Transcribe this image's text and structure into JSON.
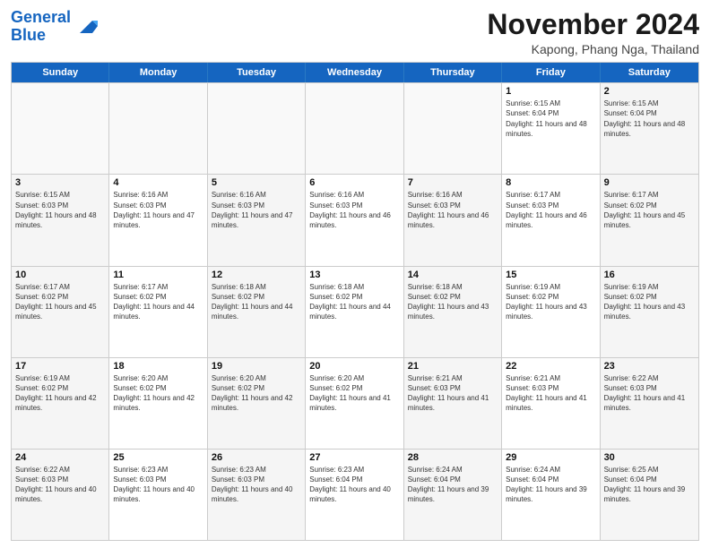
{
  "logo": {
    "line1": "General",
    "line2": "Blue"
  },
  "title": "November 2024",
  "subtitle": "Kapong, Phang Nga, Thailand",
  "days_of_week": [
    "Sunday",
    "Monday",
    "Tuesday",
    "Wednesday",
    "Thursday",
    "Friday",
    "Saturday"
  ],
  "weeks": [
    [
      {
        "day": "",
        "sunrise": "",
        "sunset": "",
        "daylight": "",
        "empty": true
      },
      {
        "day": "",
        "sunrise": "",
        "sunset": "",
        "daylight": "",
        "empty": true
      },
      {
        "day": "",
        "sunrise": "",
        "sunset": "",
        "daylight": "",
        "empty": true
      },
      {
        "day": "",
        "sunrise": "",
        "sunset": "",
        "daylight": "",
        "empty": true
      },
      {
        "day": "",
        "sunrise": "",
        "sunset": "",
        "daylight": "",
        "empty": true
      },
      {
        "day": "1",
        "sunrise": "Sunrise: 6:15 AM",
        "sunset": "Sunset: 6:04 PM",
        "daylight": "Daylight: 11 hours and 48 minutes.",
        "empty": false
      },
      {
        "day": "2",
        "sunrise": "Sunrise: 6:15 AM",
        "sunset": "Sunset: 6:04 PM",
        "daylight": "Daylight: 11 hours and 48 minutes.",
        "empty": false
      }
    ],
    [
      {
        "day": "3",
        "sunrise": "Sunrise: 6:15 AM",
        "sunset": "Sunset: 6:03 PM",
        "daylight": "Daylight: 11 hours and 48 minutes.",
        "empty": false
      },
      {
        "day": "4",
        "sunrise": "Sunrise: 6:16 AM",
        "sunset": "Sunset: 6:03 PM",
        "daylight": "Daylight: 11 hours and 47 minutes.",
        "empty": false
      },
      {
        "day": "5",
        "sunrise": "Sunrise: 6:16 AM",
        "sunset": "Sunset: 6:03 PM",
        "daylight": "Daylight: 11 hours and 47 minutes.",
        "empty": false
      },
      {
        "day": "6",
        "sunrise": "Sunrise: 6:16 AM",
        "sunset": "Sunset: 6:03 PM",
        "daylight": "Daylight: 11 hours and 46 minutes.",
        "empty": false
      },
      {
        "day": "7",
        "sunrise": "Sunrise: 6:16 AM",
        "sunset": "Sunset: 6:03 PM",
        "daylight": "Daylight: 11 hours and 46 minutes.",
        "empty": false
      },
      {
        "day": "8",
        "sunrise": "Sunrise: 6:17 AM",
        "sunset": "Sunset: 6:03 PM",
        "daylight": "Daylight: 11 hours and 46 minutes.",
        "empty": false
      },
      {
        "day": "9",
        "sunrise": "Sunrise: 6:17 AM",
        "sunset": "Sunset: 6:02 PM",
        "daylight": "Daylight: 11 hours and 45 minutes.",
        "empty": false
      }
    ],
    [
      {
        "day": "10",
        "sunrise": "Sunrise: 6:17 AM",
        "sunset": "Sunset: 6:02 PM",
        "daylight": "Daylight: 11 hours and 45 minutes.",
        "empty": false
      },
      {
        "day": "11",
        "sunrise": "Sunrise: 6:17 AM",
        "sunset": "Sunset: 6:02 PM",
        "daylight": "Daylight: 11 hours and 44 minutes.",
        "empty": false
      },
      {
        "day": "12",
        "sunrise": "Sunrise: 6:18 AM",
        "sunset": "Sunset: 6:02 PM",
        "daylight": "Daylight: 11 hours and 44 minutes.",
        "empty": false
      },
      {
        "day": "13",
        "sunrise": "Sunrise: 6:18 AM",
        "sunset": "Sunset: 6:02 PM",
        "daylight": "Daylight: 11 hours and 44 minutes.",
        "empty": false
      },
      {
        "day": "14",
        "sunrise": "Sunrise: 6:18 AM",
        "sunset": "Sunset: 6:02 PM",
        "daylight": "Daylight: 11 hours and 43 minutes.",
        "empty": false
      },
      {
        "day": "15",
        "sunrise": "Sunrise: 6:19 AM",
        "sunset": "Sunset: 6:02 PM",
        "daylight": "Daylight: 11 hours and 43 minutes.",
        "empty": false
      },
      {
        "day": "16",
        "sunrise": "Sunrise: 6:19 AM",
        "sunset": "Sunset: 6:02 PM",
        "daylight": "Daylight: 11 hours and 43 minutes.",
        "empty": false
      }
    ],
    [
      {
        "day": "17",
        "sunrise": "Sunrise: 6:19 AM",
        "sunset": "Sunset: 6:02 PM",
        "daylight": "Daylight: 11 hours and 42 minutes.",
        "empty": false
      },
      {
        "day": "18",
        "sunrise": "Sunrise: 6:20 AM",
        "sunset": "Sunset: 6:02 PM",
        "daylight": "Daylight: 11 hours and 42 minutes.",
        "empty": false
      },
      {
        "day": "19",
        "sunrise": "Sunrise: 6:20 AM",
        "sunset": "Sunset: 6:02 PM",
        "daylight": "Daylight: 11 hours and 42 minutes.",
        "empty": false
      },
      {
        "day": "20",
        "sunrise": "Sunrise: 6:20 AM",
        "sunset": "Sunset: 6:02 PM",
        "daylight": "Daylight: 11 hours and 41 minutes.",
        "empty": false
      },
      {
        "day": "21",
        "sunrise": "Sunrise: 6:21 AM",
        "sunset": "Sunset: 6:03 PM",
        "daylight": "Daylight: 11 hours and 41 minutes.",
        "empty": false
      },
      {
        "day": "22",
        "sunrise": "Sunrise: 6:21 AM",
        "sunset": "Sunset: 6:03 PM",
        "daylight": "Daylight: 11 hours and 41 minutes.",
        "empty": false
      },
      {
        "day": "23",
        "sunrise": "Sunrise: 6:22 AM",
        "sunset": "Sunset: 6:03 PM",
        "daylight": "Daylight: 11 hours and 41 minutes.",
        "empty": false
      }
    ],
    [
      {
        "day": "24",
        "sunrise": "Sunrise: 6:22 AM",
        "sunset": "Sunset: 6:03 PM",
        "daylight": "Daylight: 11 hours and 40 minutes.",
        "empty": false
      },
      {
        "day": "25",
        "sunrise": "Sunrise: 6:23 AM",
        "sunset": "Sunset: 6:03 PM",
        "daylight": "Daylight: 11 hours and 40 minutes.",
        "empty": false
      },
      {
        "day": "26",
        "sunrise": "Sunrise: 6:23 AM",
        "sunset": "Sunset: 6:03 PM",
        "daylight": "Daylight: 11 hours and 40 minutes.",
        "empty": false
      },
      {
        "day": "27",
        "sunrise": "Sunrise: 6:23 AM",
        "sunset": "Sunset: 6:04 PM",
        "daylight": "Daylight: 11 hours and 40 minutes.",
        "empty": false
      },
      {
        "day": "28",
        "sunrise": "Sunrise: 6:24 AM",
        "sunset": "Sunset: 6:04 PM",
        "daylight": "Daylight: 11 hours and 39 minutes.",
        "empty": false
      },
      {
        "day": "29",
        "sunrise": "Sunrise: 6:24 AM",
        "sunset": "Sunset: 6:04 PM",
        "daylight": "Daylight: 11 hours and 39 minutes.",
        "empty": false
      },
      {
        "day": "30",
        "sunrise": "Sunrise: 6:25 AM",
        "sunset": "Sunset: 6:04 PM",
        "daylight": "Daylight: 11 hours and 39 minutes.",
        "empty": false
      }
    ]
  ]
}
